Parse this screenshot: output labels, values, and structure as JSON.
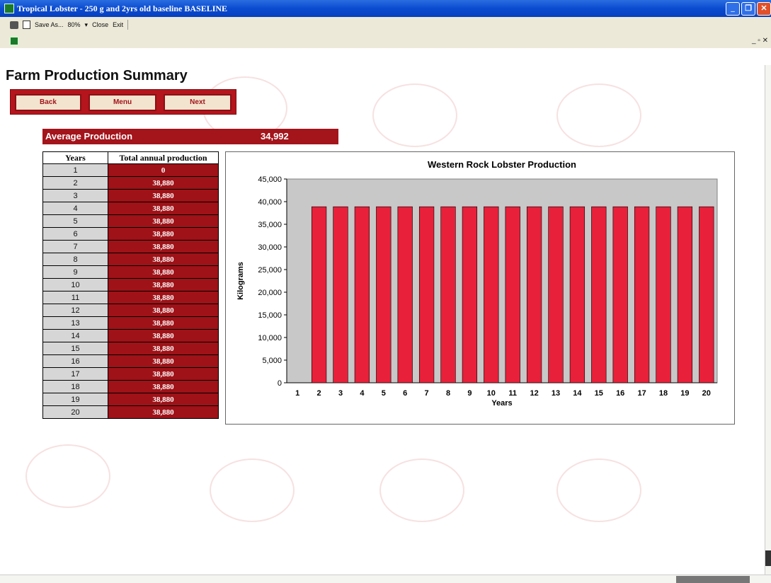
{
  "window": {
    "title": "Tropical Lobster - 250 g and 2yrs old baseline BASELINE"
  },
  "toolbar": {
    "save_as": "Save As...",
    "zoom": "80%",
    "close": "Close",
    "exit": "Exit"
  },
  "page": {
    "title": "Farm Production Summary"
  },
  "nav": {
    "back": "Back",
    "menu": "Menu",
    "next": "Next"
  },
  "summary": {
    "average_label": "Average Production",
    "average_value": "34,992"
  },
  "table": {
    "headers": [
      "Years",
      "Total annual production"
    ],
    "rows": [
      {
        "year": "1",
        "value": "0"
      },
      {
        "year": "2",
        "value": "38,880"
      },
      {
        "year": "3",
        "value": "38,880"
      },
      {
        "year": "4",
        "value": "38,880"
      },
      {
        "year": "5",
        "value": "38,880"
      },
      {
        "year": "6",
        "value": "38,880"
      },
      {
        "year": "7",
        "value": "38,880"
      },
      {
        "year": "8",
        "value": "38,880"
      },
      {
        "year": "9",
        "value": "38,880"
      },
      {
        "year": "10",
        "value": "38,880"
      },
      {
        "year": "11",
        "value": "38,880"
      },
      {
        "year": "12",
        "value": "38,880"
      },
      {
        "year": "13",
        "value": "38,880"
      },
      {
        "year": "14",
        "value": "38,880"
      },
      {
        "year": "15",
        "value": "38,880"
      },
      {
        "year": "16",
        "value": "38,880"
      },
      {
        "year": "17",
        "value": "38,880"
      },
      {
        "year": "18",
        "value": "38,880"
      },
      {
        "year": "19",
        "value": "38,880"
      },
      {
        "year": "20",
        "value": "38,880"
      }
    ]
  },
  "chart_data": {
    "type": "bar",
    "title": "Western Rock Lobster Production",
    "xlabel": "Years",
    "ylabel": "Kilograms",
    "categories": [
      "1",
      "2",
      "3",
      "4",
      "5",
      "6",
      "7",
      "8",
      "9",
      "10",
      "11",
      "12",
      "13",
      "14",
      "15",
      "16",
      "17",
      "18",
      "19",
      "20"
    ],
    "values": [
      0,
      38880,
      38880,
      38880,
      38880,
      38880,
      38880,
      38880,
      38880,
      38880,
      38880,
      38880,
      38880,
      38880,
      38880,
      38880,
      38880,
      38880,
      38880,
      38880
    ],
    "ylim": [
      0,
      45000
    ],
    "yticks": [
      "0",
      "5,000",
      "10,000",
      "15,000",
      "20,000",
      "25,000",
      "30,000",
      "35,000",
      "40,000",
      "45,000"
    ],
    "grid": false,
    "colors": {
      "bar": "#e8203a",
      "plot_bg": "#c8c8c8"
    }
  }
}
